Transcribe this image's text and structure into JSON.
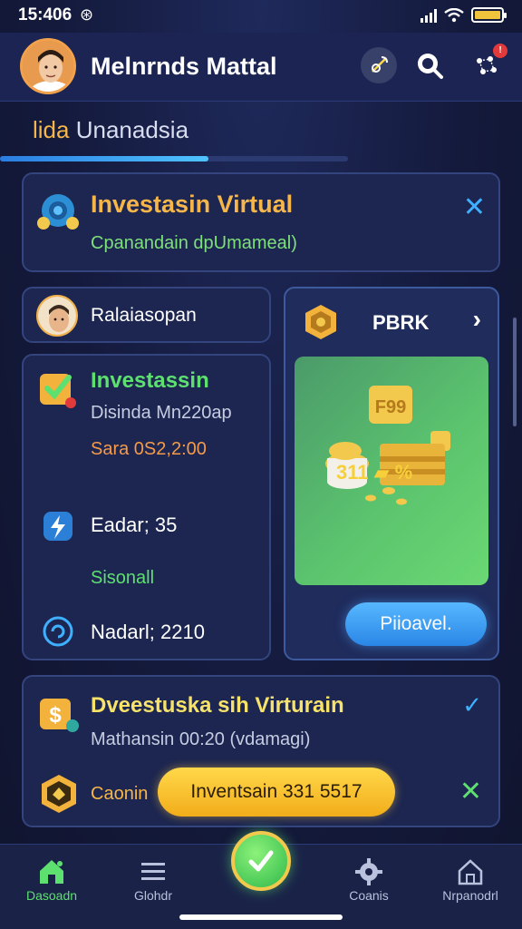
{
  "status_bar": {
    "time": "15:406",
    "glyph": "⊛"
  },
  "header": {
    "user_name": "Melnrnds Mattal",
    "icons": [
      "satellite-icon",
      "search-icon",
      "network-icon"
    ],
    "notification_badge": "!"
  },
  "tabs": {
    "active": "lida",
    "rest": "Unanadsia",
    "progress_fraction": 0.6
  },
  "banner": {
    "title": "Investasin Virtual",
    "subtitle": "Cpanandain dpUmameal)"
  },
  "profile": {
    "name": "Ralaiasopan"
  },
  "investment": {
    "title": "Investassin",
    "line1": "Disinda Mn220ap",
    "line2": "Sara 0S2,2:00",
    "stats": [
      {
        "label": "Eadar; 35"
      },
      {
        "label": "Sisonall"
      },
      {
        "label": "Nadarl; 2210"
      }
    ]
  },
  "promo": {
    "label": "PBRK",
    "value": "311 ▰ %",
    "button": "Piioavel."
  },
  "bottom_card": {
    "title": "Dveestuska sih Virturain",
    "subtitle": "Mathansin 00:20 (vdamagi)",
    "label": "Caonin",
    "cta": "Inventsain 331 5517"
  },
  "nav": {
    "items": [
      {
        "label": "Dasoadn",
        "icon": "home-icon"
      },
      {
        "label": "Glohdr",
        "icon": "list-icon"
      },
      {
        "label": "Coanis",
        "icon": "gear-icon"
      },
      {
        "label": "Nrpanodrl",
        "icon": "house-outline-icon"
      }
    ]
  },
  "colors": {
    "background": "#151a3a",
    "accent_orange": "#f6b64a",
    "accent_green": "#5ee071",
    "accent_blue": "#3fb0ff",
    "cta_yellow": "#ffd84a"
  }
}
